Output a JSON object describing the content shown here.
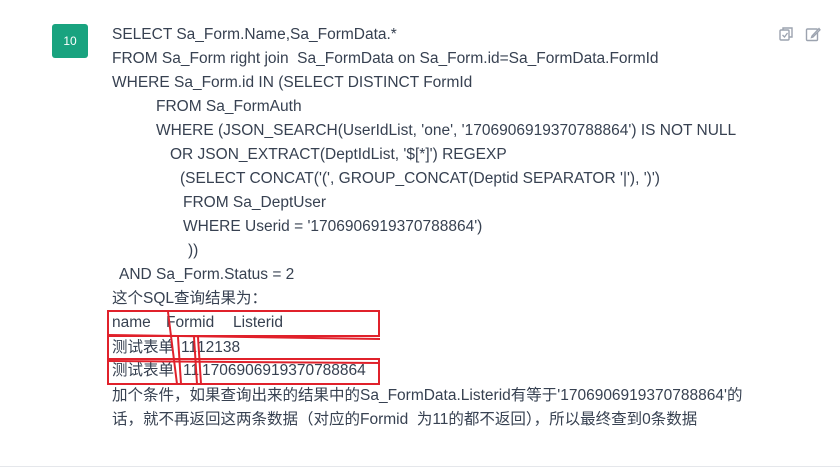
{
  "message": {
    "avatar_label": "10",
    "sql_lines": [
      "SELECT Sa_Form.Name,Sa_FormData.*",
      "FROM Sa_Form right join  Sa_FormData on Sa_Form.id=Sa_FormData.FormId",
      "WHERE Sa_Form.id IN (SELECT DISTINCT FormId",
      "FROM Sa_FormAuth",
      "WHERE (JSON_SEARCH(UserIdList, 'one', '1706906919370788864') IS NOT NULL",
      "OR JSON_EXTRACT(DeptIdList, '$[*]') REGEXP",
      "(SELECT CONCAT('(', GROUP_CONCAT(Deptid SEPARATOR '|'), ')')",
      "FROM Sa_DeptUser",
      "WHERE Userid = '1706906919370788864')",
      "))",
      "AND Sa_Form.Status = 2"
    ],
    "result_intro": "这个SQL查询结果为：",
    "result_table": {
      "headers": [
        "name",
        "Formid",
        "Listerid"
      ],
      "rows": [
        [
          "测试表单",
          "11",
          "12138"
        ],
        [
          "测试表单",
          "11",
          "1706906919370788864"
        ]
      ]
    },
    "explanation_lines": [
      "加个条件，如果查询出来的结果中的Sa_FormData.Listerid有等于'1706906919370788864'的",
      "话，就不再返回这两条数据（对应的Formid  为11的都不返回），所以最终查到0条数据"
    ]
  },
  "toolbar": {
    "copy_icon": "clipboard-icon",
    "edit_icon": "edit-icon"
  },
  "colors": {
    "avatar": "#19a37f",
    "annotation": "#e0212b",
    "text": "#374151"
  }
}
